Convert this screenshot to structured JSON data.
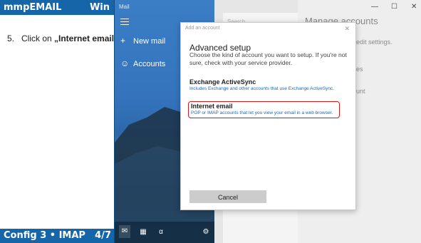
{
  "guide": {
    "header_left": "mmpEMAIL",
    "header_right": "Win",
    "step_number": "5.",
    "step_prefix": "Click on ",
    "step_target": "„Internet email“",
    "footer_left": "Config 3 • IMAP",
    "footer_right": "4/7"
  },
  "mail": {
    "window_title": "Mail",
    "new_mail": "New mail",
    "accounts": "Accounts"
  },
  "backdrop": {
    "search_placeholder": "Search",
    "manage_accounts": "Manage accounts",
    "frag_edit": "edit settings.",
    "frag_es": "es",
    "frag_unt": "unt"
  },
  "dialog": {
    "title": "Add an account",
    "heading": "Advanced setup",
    "description": "Choose the kind of account you want to setup. If you're not sure, check with your service provider.",
    "options": [
      {
        "title": "Exchange ActiveSync",
        "subtitle": "Includes Exchange and other accounts that use Exchange ActiveSync."
      },
      {
        "title": "Internet email",
        "subtitle": "POP or IMAP accounts that let you view your email in a web browser."
      }
    ],
    "cancel": "Cancel"
  },
  "colors": {
    "guide_bar": "#1565a8",
    "highlight": "#d11a1a",
    "link": "#1a6bb8"
  }
}
